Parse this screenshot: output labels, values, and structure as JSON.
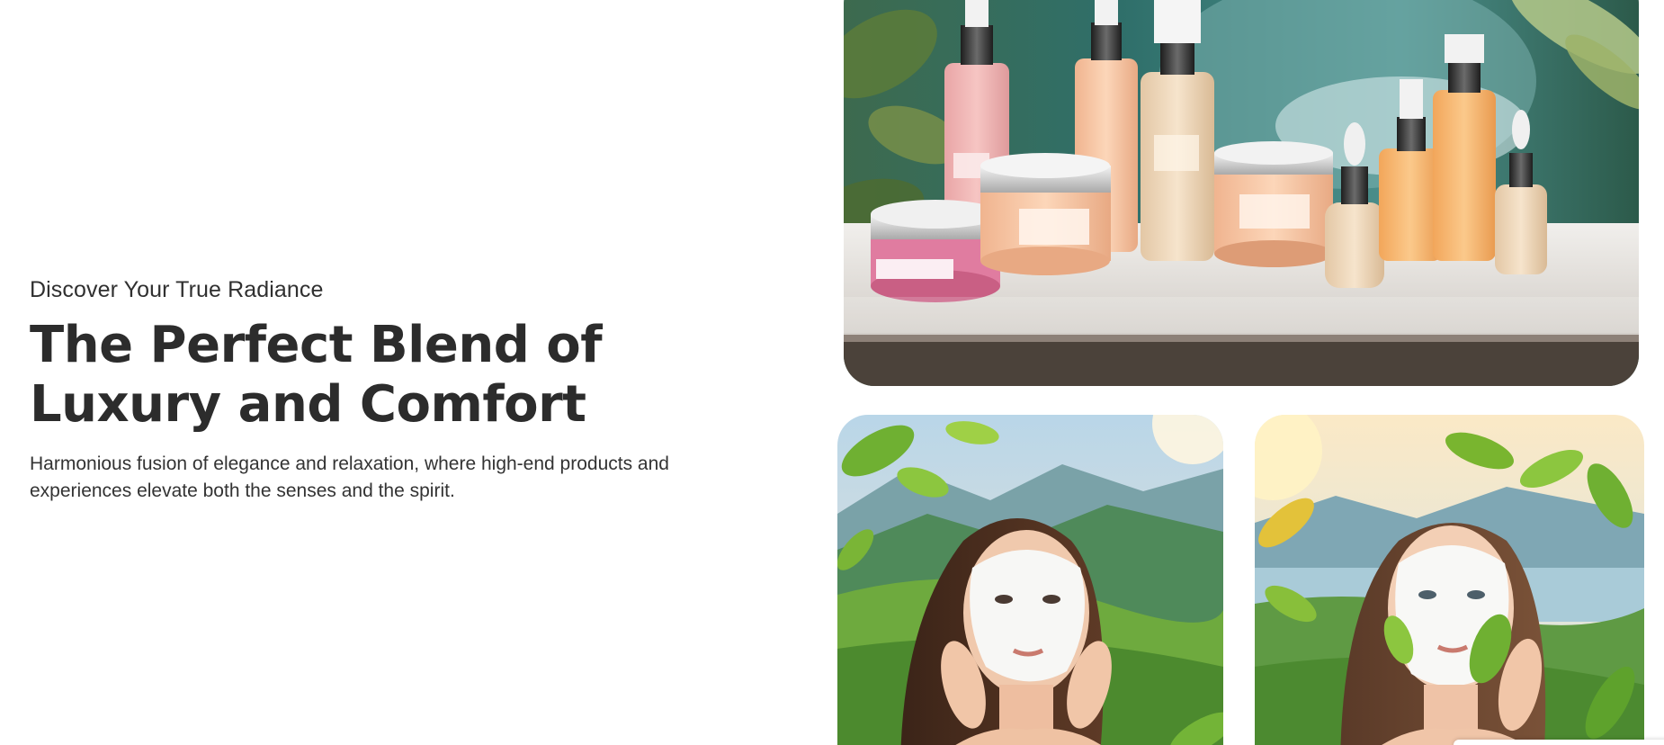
{
  "hero": {
    "eyebrow": "Discover Your True Radiance",
    "headline": "The Perfect Blend of Luxury and Comfort",
    "body": "Harmonious fusion of elegance and relaxation, where high-end products and experiences elevate both the senses and the spirit."
  },
  "gallery": {
    "images": [
      {
        "subject": "skincare bottles and jars on a marble shelf with green foliage background"
      },
      {
        "subject": "woman with white face mask in a green mountain valley"
      },
      {
        "subject": "woman with white face mask holding a leaf by a lake"
      }
    ]
  },
  "colors": {
    "text_dark": "#2c2c2c",
    "background": "#ffffff"
  }
}
